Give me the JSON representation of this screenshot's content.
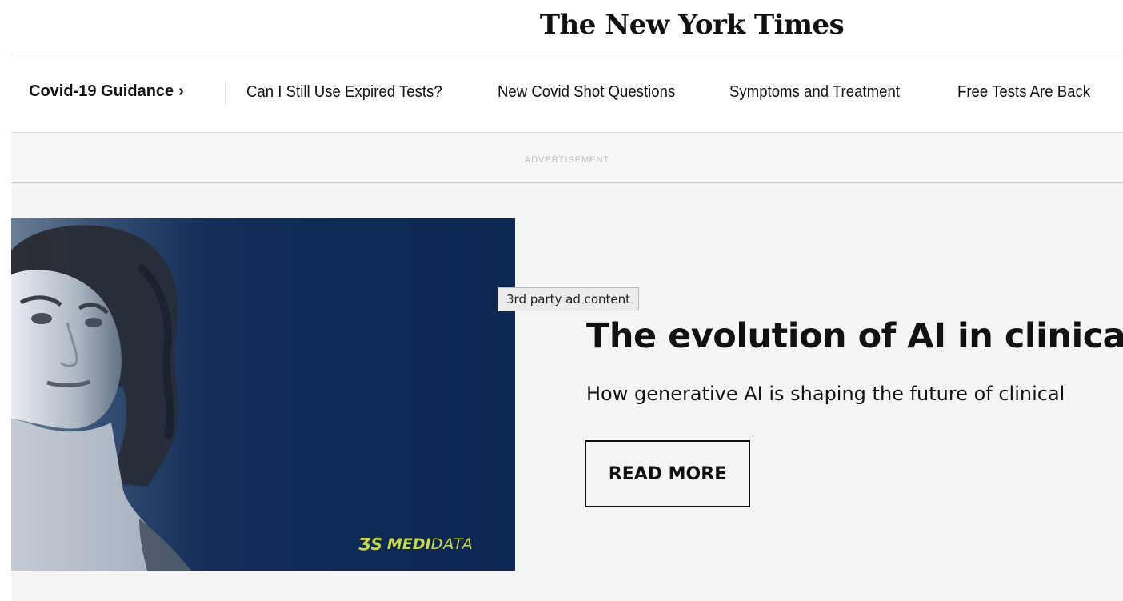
{
  "masthead": {
    "logo_text": "The New York Times"
  },
  "guidance": {
    "title": "Covid-19 Guidance",
    "chevron": "›",
    "links": [
      "Can I Still Use Expired Tests?",
      "New Covid Shot Questions",
      "Symptoms and Treatment",
      "Free Tests Are Back"
    ]
  },
  "ad": {
    "label": "ADVERTISEMENT",
    "tooltip": "3rd party ad content",
    "headline": "The evolution of AI in clinical t",
    "subhead": "How generative AI is shaping the future of clinical",
    "cta": "READ MORE",
    "brand": {
      "ds": "ƷS",
      "bold": "MEDI",
      "light": "DATA"
    },
    "image_icon": "woman-portrait-image"
  },
  "colors": {
    "ad_background": "#f5f5f5",
    "ad_navy": "#0f2a55",
    "brand_lime": "#c8d84a",
    "text": "#121212",
    "rule": "#dcdcdc"
  }
}
